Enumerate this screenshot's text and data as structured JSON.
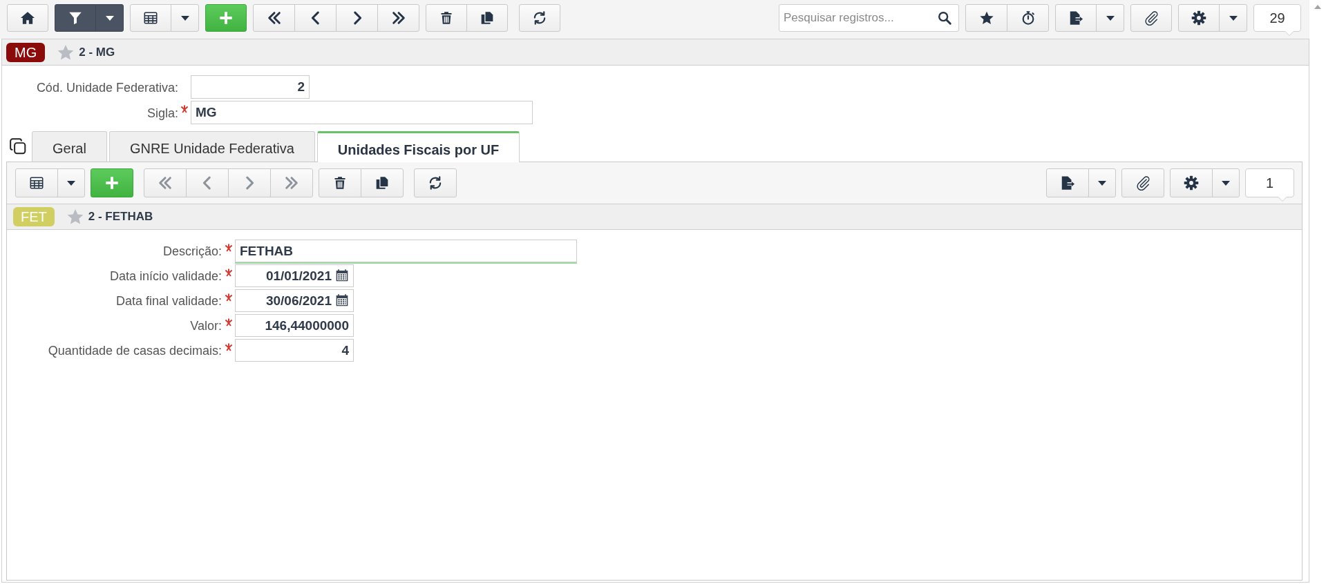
{
  "toolbar": {
    "filter_active": true,
    "navigation_disabled": false,
    "search": {
      "placeholder": "Pesquisar registros..."
    },
    "record_count": "29"
  },
  "record": {
    "badge": {
      "text": "MG",
      "color": "#8b0a0a"
    },
    "favorite": false,
    "title": "2 - MG"
  },
  "fields": [
    {
      "label": "Cód. Unidade Federativa:",
      "required": false,
      "kind": "number",
      "value": "2",
      "focused": false
    },
    {
      "label": "Sigla:",
      "required": true,
      "kind": "text",
      "value": "MG",
      "focused": false
    }
  ],
  "tabs": [
    {
      "label": "Geral",
      "selected": false
    },
    {
      "label": "GNRE Unidade Federativa",
      "selected": false
    },
    {
      "label": "Unidades Fiscais por UF",
      "selected": true
    }
  ],
  "detail": {
    "toolbar": {
      "navigation_disabled": true,
      "record_count": "1"
    },
    "record": {
      "badge": {
        "text": "FET",
        "color": "#d2cf62"
      },
      "favorite": false,
      "title": "2 - FETHAB"
    },
    "fields": [
      {
        "label": "Descrição:",
        "required": true,
        "kind": "text",
        "value": "FETHAB",
        "focused": true
      },
      {
        "label": "Data início validade:",
        "required": true,
        "kind": "date",
        "value": "01/01/2021",
        "focused": false
      },
      {
        "label": "Data final validade:",
        "required": true,
        "kind": "date",
        "value": "30/06/2021",
        "focused": false
      },
      {
        "label": "Valor:",
        "required": true,
        "kind": "number",
        "value": "146,44000000",
        "focused": false
      },
      {
        "label": "Quantidade de casas decimais:",
        "required": true,
        "kind": "number",
        "value": "4",
        "focused": false
      }
    ]
  }
}
